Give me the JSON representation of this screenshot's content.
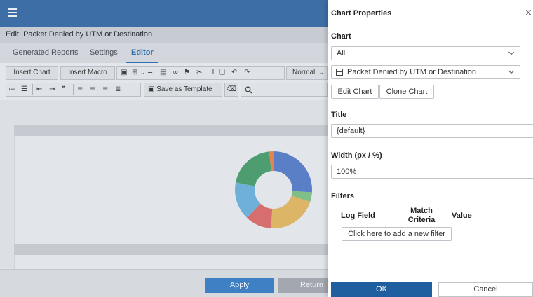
{
  "editor": {
    "title": "Edit: Packet Denied by UTM or Destination",
    "tabs": [
      {
        "label": "Generated Reports"
      },
      {
        "label": "Settings"
      },
      {
        "label": "Editor"
      }
    ],
    "toolbar": {
      "insert_chart": "Insert Chart",
      "insert_macro": "Insert Macro",
      "format_select": "Normal",
      "save_template": "Save as Template"
    },
    "apply_label": "Apply",
    "return_label": "Return",
    "donut": {
      "segments": [
        {
          "color": "#5a7fc6",
          "value": 26
        },
        {
          "color": "#7fbf86",
          "value": 4
        },
        {
          "color": "#dcb567",
          "value": 21
        },
        {
          "color": "#d66e70",
          "value": 11
        },
        {
          "color": "#6fb0d8",
          "value": 16
        },
        {
          "color": "#4d9d70",
          "value": 20
        },
        {
          "color": "#e8834f",
          "value": 2
        }
      ]
    }
  },
  "panel": {
    "title": "Chart Properties",
    "chart_section": "Chart",
    "category_select": "All",
    "chart_select": "Packet Denied by UTM or Destination",
    "edit_chart": "Edit Chart",
    "clone_chart": "Clone Chart",
    "title_section": "Title",
    "title_value": "{default}",
    "width_section": "Width (px / %)",
    "width_value": "100%",
    "filters_section": "Filters",
    "filter_columns": {
      "log_field": "Log Field",
      "match_criteria": "Match Criteria",
      "value": "Value"
    },
    "add_filter": "Click here to add a new filter",
    "ok_label": "OK",
    "cancel_label": "Cancel"
  }
}
